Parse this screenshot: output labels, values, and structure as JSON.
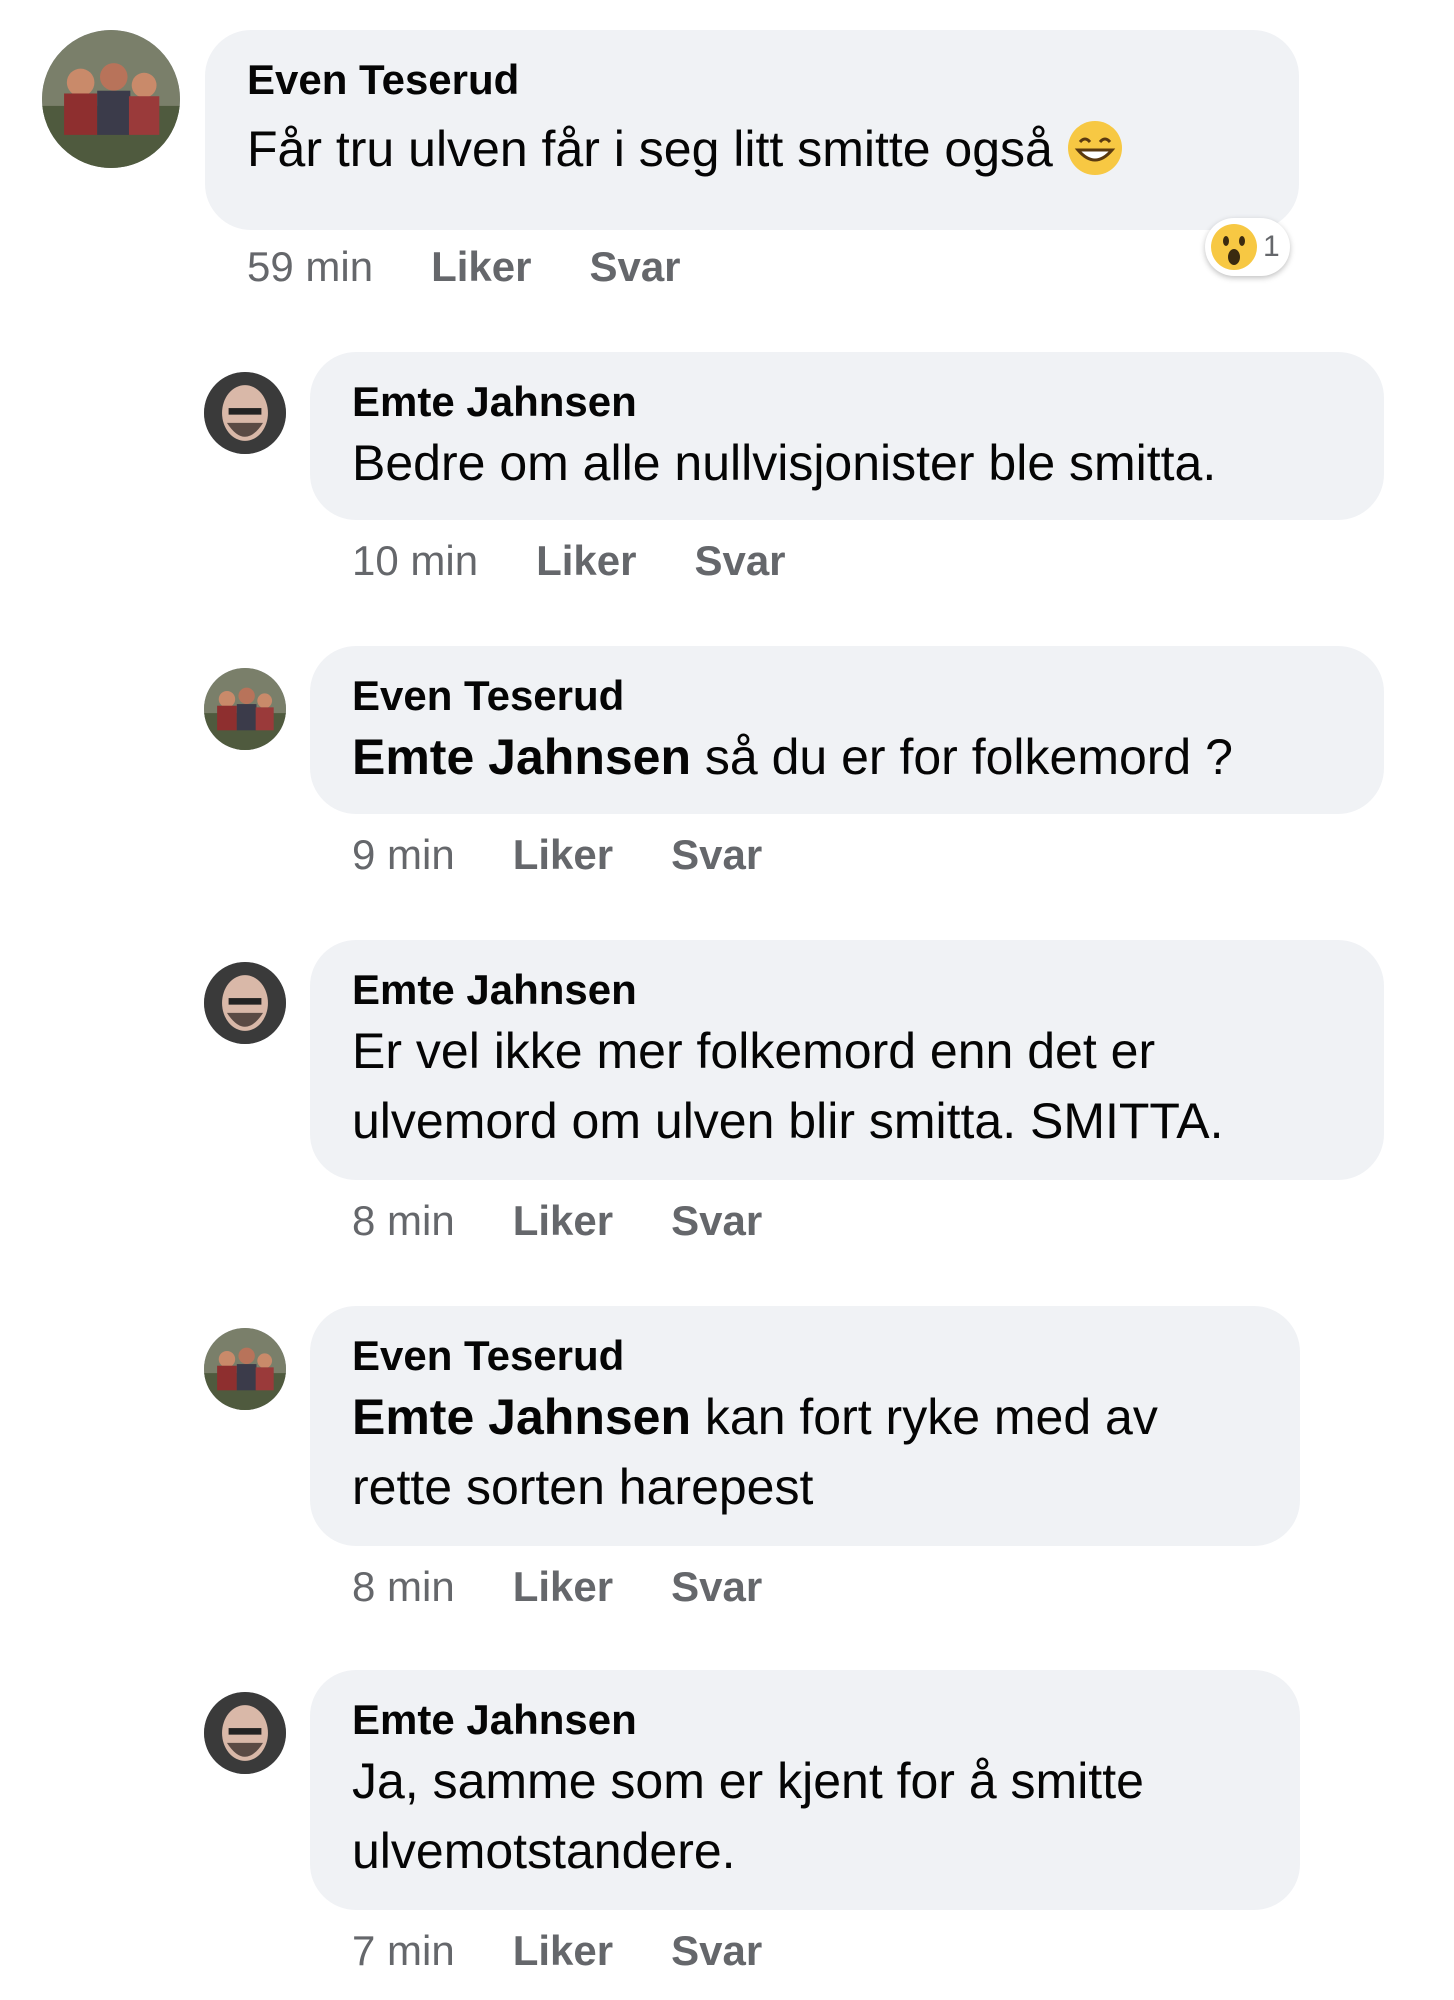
{
  "comments": [
    {
      "author": "Even Teserud",
      "mention": "",
      "text": "Får tru ulven får i seg litt smitte også",
      "emoji": "grinning-face-icon",
      "time": "59 min",
      "like_label": "Liker",
      "reply_label": "Svar",
      "reaction": {
        "icon": "wow-reaction-icon",
        "count": "1"
      }
    },
    {
      "author": "Emte Jahnsen",
      "mention": "",
      "text": "Bedre om alle nullvisjonister ble smitta.",
      "time": "10 min",
      "like_label": "Liker",
      "reply_label": "Svar"
    },
    {
      "author": "Even Teserud",
      "mention": "Emte Jahnsen",
      "text": " så du er for folkemord ?",
      "time": "9 min",
      "like_label": "Liker",
      "reply_label": "Svar"
    },
    {
      "author": "Emte Jahnsen",
      "mention": "",
      "text": "Er vel ikke mer folkemord enn det er ulvemord om ulven blir smitta. SMITTA.",
      "time": "8 min",
      "like_label": "Liker",
      "reply_label": "Svar"
    },
    {
      "author": "Even Teserud",
      "mention": "Emte Jahnsen",
      "text": " kan fort ryke med av rette sorten harepest",
      "time": "8 min",
      "like_label": "Liker",
      "reply_label": "Svar"
    },
    {
      "author": "Emte Jahnsen",
      "mention": "",
      "text": "Ja, samme som er kjent for å smitte ulvemotstandere.",
      "time": "7 min",
      "like_label": "Liker",
      "reply_label": "Svar"
    }
  ]
}
